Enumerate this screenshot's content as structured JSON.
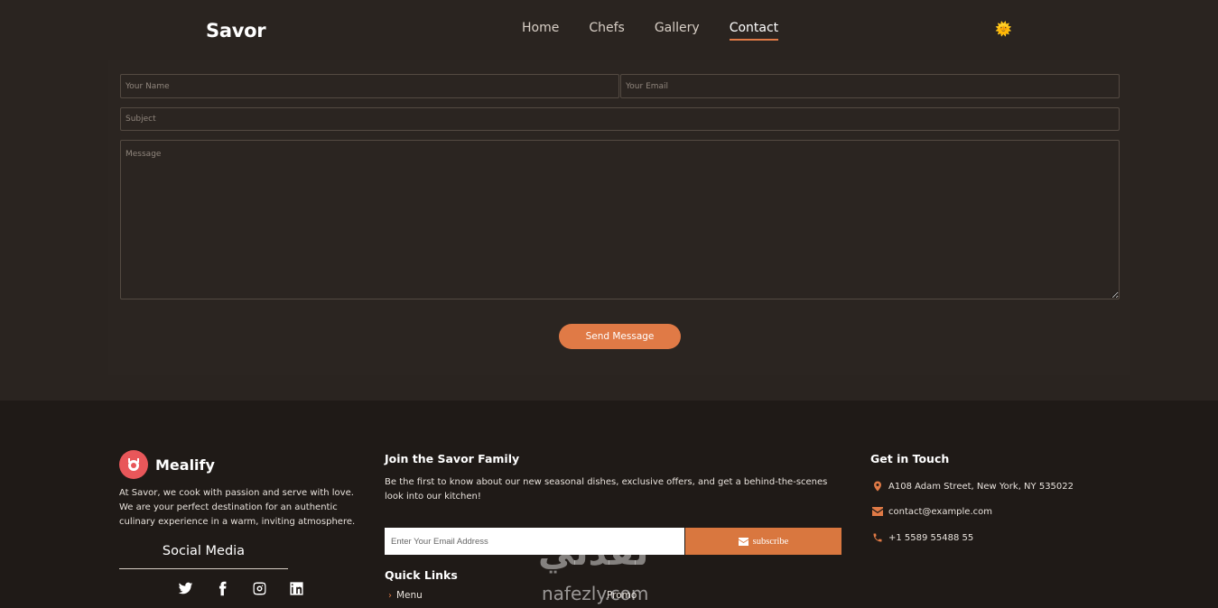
{
  "header": {
    "logo": "Savor",
    "nav": [
      "Home",
      "Chefs",
      "Gallery",
      "Contact"
    ],
    "active_nav": "Contact",
    "theme_icon": "sun-icon",
    "theme_glyph": "🌞"
  },
  "form": {
    "name_placeholder": "Your Name",
    "email_placeholder": "Your Email",
    "subject_placeholder": "Subject",
    "message_placeholder": "Message",
    "send_label": "Send Message"
  },
  "footer": {
    "brand": {
      "name": "Mealify",
      "icon": "chef-logo-icon"
    },
    "about": "At Savor, we cook with passion and serve with love. We are your perfect destination for an authentic culinary experience in a warm, inviting atmosphere.",
    "social_title": "Social Media",
    "social": [
      "twitter-icon",
      "facebook-icon",
      "instagram-icon",
      "linkedin-icon"
    ],
    "join_title": "Join the Savor Family",
    "join_text": "Be the first to know about our new seasonal dishes, exclusive offers, and get a behind-the-scenes look into our kitchen!",
    "subscribe_placeholder": "Enter Your Email Address",
    "subscribe_label": "subscribe",
    "quick_links_title": "Quick Links",
    "quick_links": [
      "Menu",
      "Promo"
    ],
    "touch_title": "Get in Touch",
    "address": "A108 Adam Street, New York, NY 535022",
    "email": "contact@example.com",
    "phone": "+1 5589 55488 55"
  },
  "watermark": {
    "arabic": "نفذلي",
    "latin": "nafezly.com"
  },
  "colors": {
    "accent": "#e07a46",
    "background": "#2a2420",
    "footer": "#1f1a17",
    "brand_badge": "#e8575a"
  }
}
